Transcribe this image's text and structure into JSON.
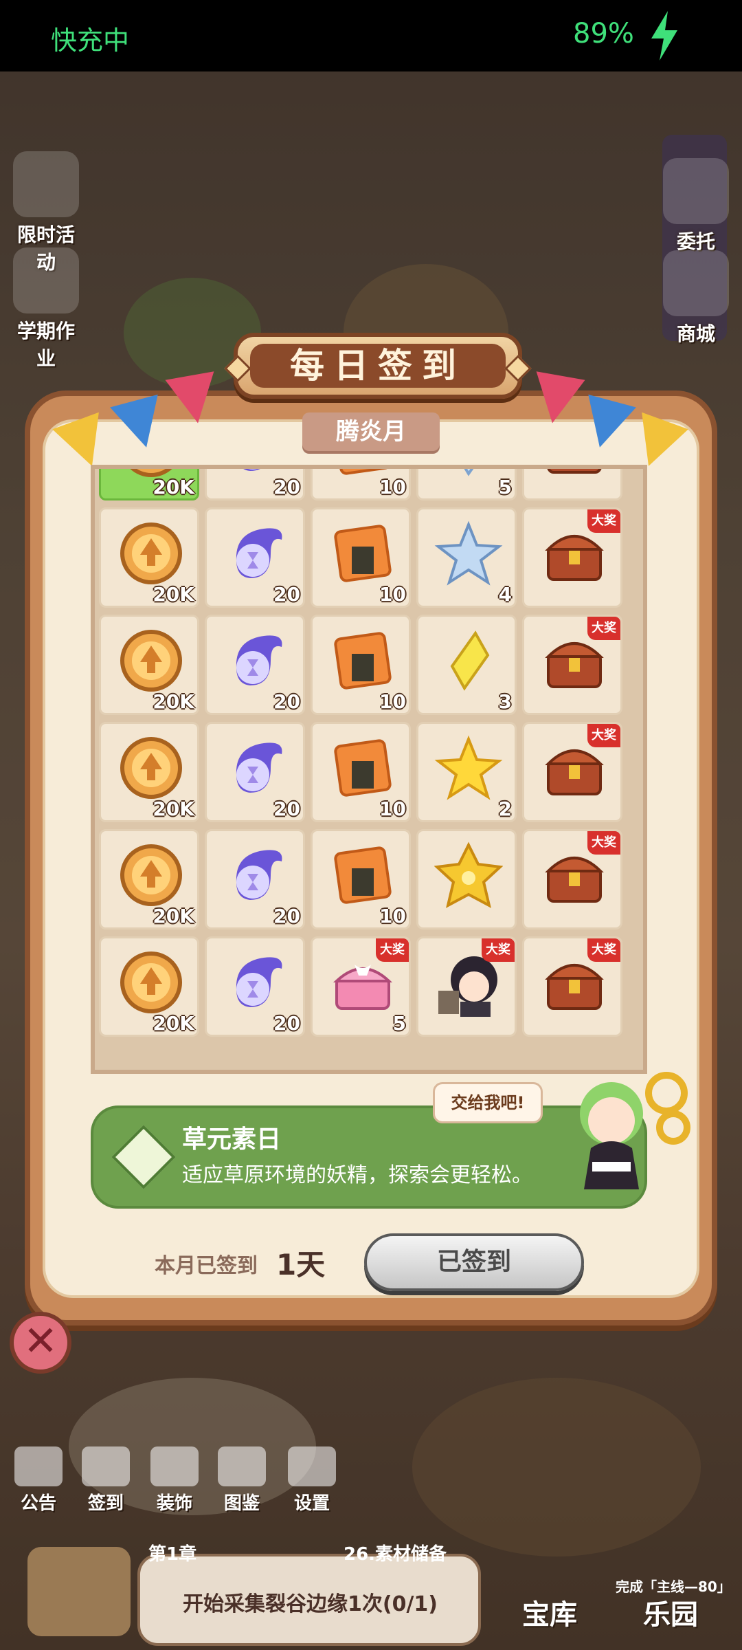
{
  "status_bar": {
    "charging_text": "快充中",
    "battery": "89%"
  },
  "left_menu": [
    {
      "label": "限时活动",
      "icon": "limited-event-icon"
    },
    {
      "label": "学期作业",
      "icon": "homework-icon"
    }
  ],
  "right_menu": [
    {
      "label": "委托",
      "icon": "commission-icon"
    },
    {
      "label": "商城",
      "icon": "shop-icon"
    }
  ],
  "dialog": {
    "title": "每日签到",
    "month": "腾炎月",
    "grand_prize_label": "大奖",
    "rows": [
      [
        {
          "item": "gold-coin",
          "count": "20K",
          "highlight": true
        },
        {
          "item": "hourglass-orb",
          "count": "20"
        },
        {
          "item": "rice-cracker",
          "count": "10"
        },
        {
          "item": "blue-crystal",
          "count": "5"
        },
        {
          "item": "treasure-chest",
          "count": ""
        }
      ],
      [
        {
          "item": "gold-coin",
          "count": "20K"
        },
        {
          "item": "hourglass-orb",
          "count": "20"
        },
        {
          "item": "rice-cracker",
          "count": "10"
        },
        {
          "item": "blue-star",
          "count": "4"
        },
        {
          "item": "treasure-chest",
          "count": "",
          "grand": true
        }
      ],
      [
        {
          "item": "gold-coin",
          "count": "20K"
        },
        {
          "item": "hourglass-orb",
          "count": "20"
        },
        {
          "item": "rice-cracker",
          "count": "10"
        },
        {
          "item": "yellow-crystal",
          "count": "3"
        },
        {
          "item": "treasure-chest",
          "count": "",
          "grand": true
        }
      ],
      [
        {
          "item": "gold-coin",
          "count": "20K"
        },
        {
          "item": "hourglass-orb",
          "count": "20"
        },
        {
          "item": "rice-cracker",
          "count": "10"
        },
        {
          "item": "yellow-star",
          "count": "2"
        },
        {
          "item": "treasure-chest",
          "count": "",
          "grand": true
        }
      ],
      [
        {
          "item": "gold-coin",
          "count": "20K"
        },
        {
          "item": "hourglass-orb",
          "count": "20"
        },
        {
          "item": "rice-cracker",
          "count": "10"
        },
        {
          "item": "gold-star",
          "count": ""
        },
        {
          "item": "treasure-chest",
          "count": "",
          "grand": true
        }
      ],
      [
        {
          "item": "gold-coin",
          "count": "20K"
        },
        {
          "item": "hourglass-orb",
          "count": "20"
        },
        {
          "item": "pink-chest",
          "count": "5",
          "grand": true
        },
        {
          "item": "character",
          "count": "",
          "grand": true
        },
        {
          "item": "treasure-chest",
          "count": "",
          "grand": true
        }
      ]
    ],
    "info": {
      "title": "草元素日",
      "desc": "适应草原环境的妖精，探索会更轻松。",
      "bubble": "交给我吧!"
    },
    "signed_label": "本月已签到",
    "signed_days": "1天",
    "signed_button": "已签到"
  },
  "bottom_nav": [
    {
      "label": "公告",
      "icon": "announcement-icon"
    },
    {
      "label": "签到",
      "icon": "checkin-icon"
    },
    {
      "label": "装饰",
      "icon": "decoration-icon"
    },
    {
      "label": "图鉴",
      "icon": "collection-icon"
    },
    {
      "label": "设置",
      "icon": "settings-icon"
    }
  ],
  "quest": {
    "chapter": "第1章",
    "name": "26.素材储备",
    "text": "开始采集裂谷边缘1次(0/1)",
    "side_text": "完成「主线—80」"
  },
  "bottom_right": [
    {
      "label": "宝库"
    },
    {
      "label": "乐园"
    }
  ],
  "colors": {
    "status_green": "#3fe07a",
    "info_green": "#6fa14e",
    "grand_red": "#d8302c",
    "highlight_green": "#8ed85a"
  }
}
